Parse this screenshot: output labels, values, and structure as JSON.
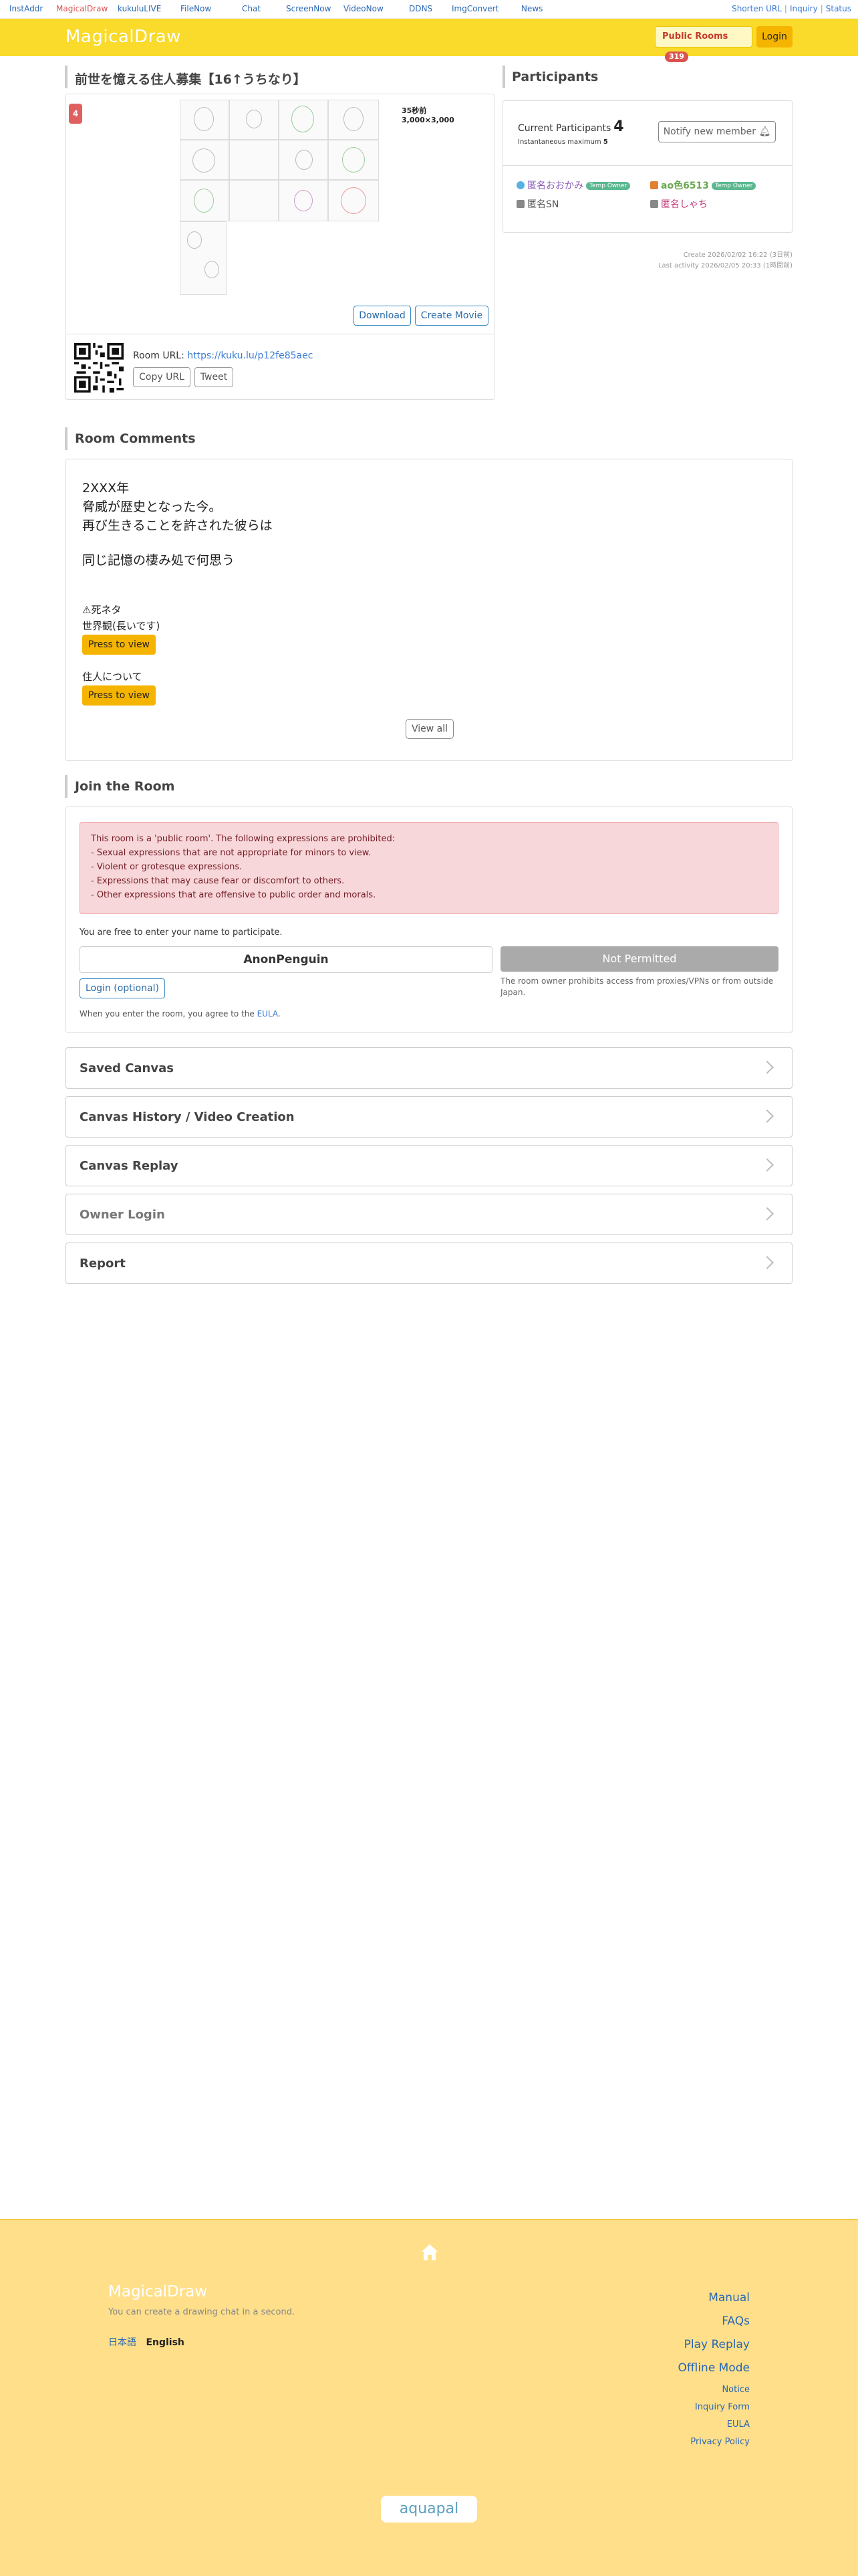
{
  "topbar": {
    "sites": [
      "InstAddr",
      "MagicalDraw",
      "kukuluLIVE",
      "FileNow",
      "Chat",
      "ScreenNow",
      "VideoNow",
      "DDNS",
      "ImgConvert",
      "News"
    ],
    "right_links": [
      "Shorten URL",
      "Inquiry",
      "Status"
    ]
  },
  "header": {
    "logo": "MagicalDraw",
    "public_rooms_label": "Public Rooms",
    "public_rooms_count": "319",
    "login_label": "Login"
  },
  "room": {
    "title": "前世を憶える住人募集【16↑うちなり】",
    "badge": "4",
    "canvas_count": "35秒前",
    "canvas_size": "3,000×3,000",
    "download_label": "Download",
    "create_movie_label": "Create Movie",
    "url_label": "Room URL: ",
    "url": "https://kuku.lu/p12fe85aec",
    "copy_url_label": "Copy URL",
    "tweet_label": "Tweet"
  },
  "participants": {
    "title": "Participants",
    "current_label": "Current Participants",
    "current_count": "4",
    "inst_max_label": "Instantaneous maximum",
    "inst_max_value": "5",
    "notify_label": "Notify new member",
    "members": [
      {
        "name": "匿名おおかみ",
        "tag": "Temp Owner",
        "color": "#8a5cb8",
        "dot": "#5ab0e0"
      },
      {
        "name": "ao色6513",
        "tag": "Temp Owner",
        "color": "#6aa84f",
        "dot": "#e08030"
      },
      {
        "name": "匿名SN",
        "tag": "",
        "color": "#555555",
        "dot": "#888888"
      },
      {
        "name": "匿名しゃち",
        "tag": "",
        "color": "#c0397a",
        "dot": "#888888"
      }
    ],
    "created": "Create 2026/02/02 16:22 (3日前)",
    "last_activity": "Last activity 2026/02/05 20:33 (1時間前)"
  },
  "comments": {
    "title": "Room Comments",
    "lines": [
      "2XXX年",
      "脅威が歴史となった今。",
      "再び生きることを許された彼らは",
      "同じ記憶の棲み処で何思う"
    ],
    "spoiler_label": "⚠死ネタ",
    "worldview_label": "世界観(長いです)",
    "press_label": "Press to view",
    "residents_label": "住人について",
    "view_all_label": "View all"
  },
  "join": {
    "title": "Join the Room",
    "warning_lines": [
      "This room is a 'public room'. The following expressions are prohibited:",
      "- Sexual expressions that are not appropriate for minors to view.",
      "- Violent or grotesque expressions.",
      "- Expressions that may cause fear or discomfort to others.",
      "- Other expressions that are offensive to public order and morals."
    ],
    "free_text": "You are free to enter your name to participate.",
    "name_value": "AnonPenguin",
    "not_permitted_label": "Not Permitted",
    "proxy_note": "The room owner prohibits access from proxies/VPNs or from outside Japan.",
    "login_optional_label": "Login (optional)",
    "eula_prefix": "When you enter the room, you agree to the ",
    "eula_link": "EULA",
    "eula_suffix": "."
  },
  "accordion": [
    "Saved Canvas",
    "Canvas History / Video Creation",
    "Canvas Replay",
    "Owner Login",
    "Report"
  ],
  "footer": {
    "logo": "MagicalDraw",
    "subtitle": "You can create a drawing chat in a second.",
    "lang_ja": "日本語",
    "lang_en": "English",
    "big_links": [
      "Manual",
      "FAQs",
      "Play Replay",
      "Offline Mode"
    ],
    "small_links": [
      "Notice",
      "Inquiry Form",
      "EULA",
      "Privacy Policy"
    ],
    "brand": "aquapal"
  }
}
